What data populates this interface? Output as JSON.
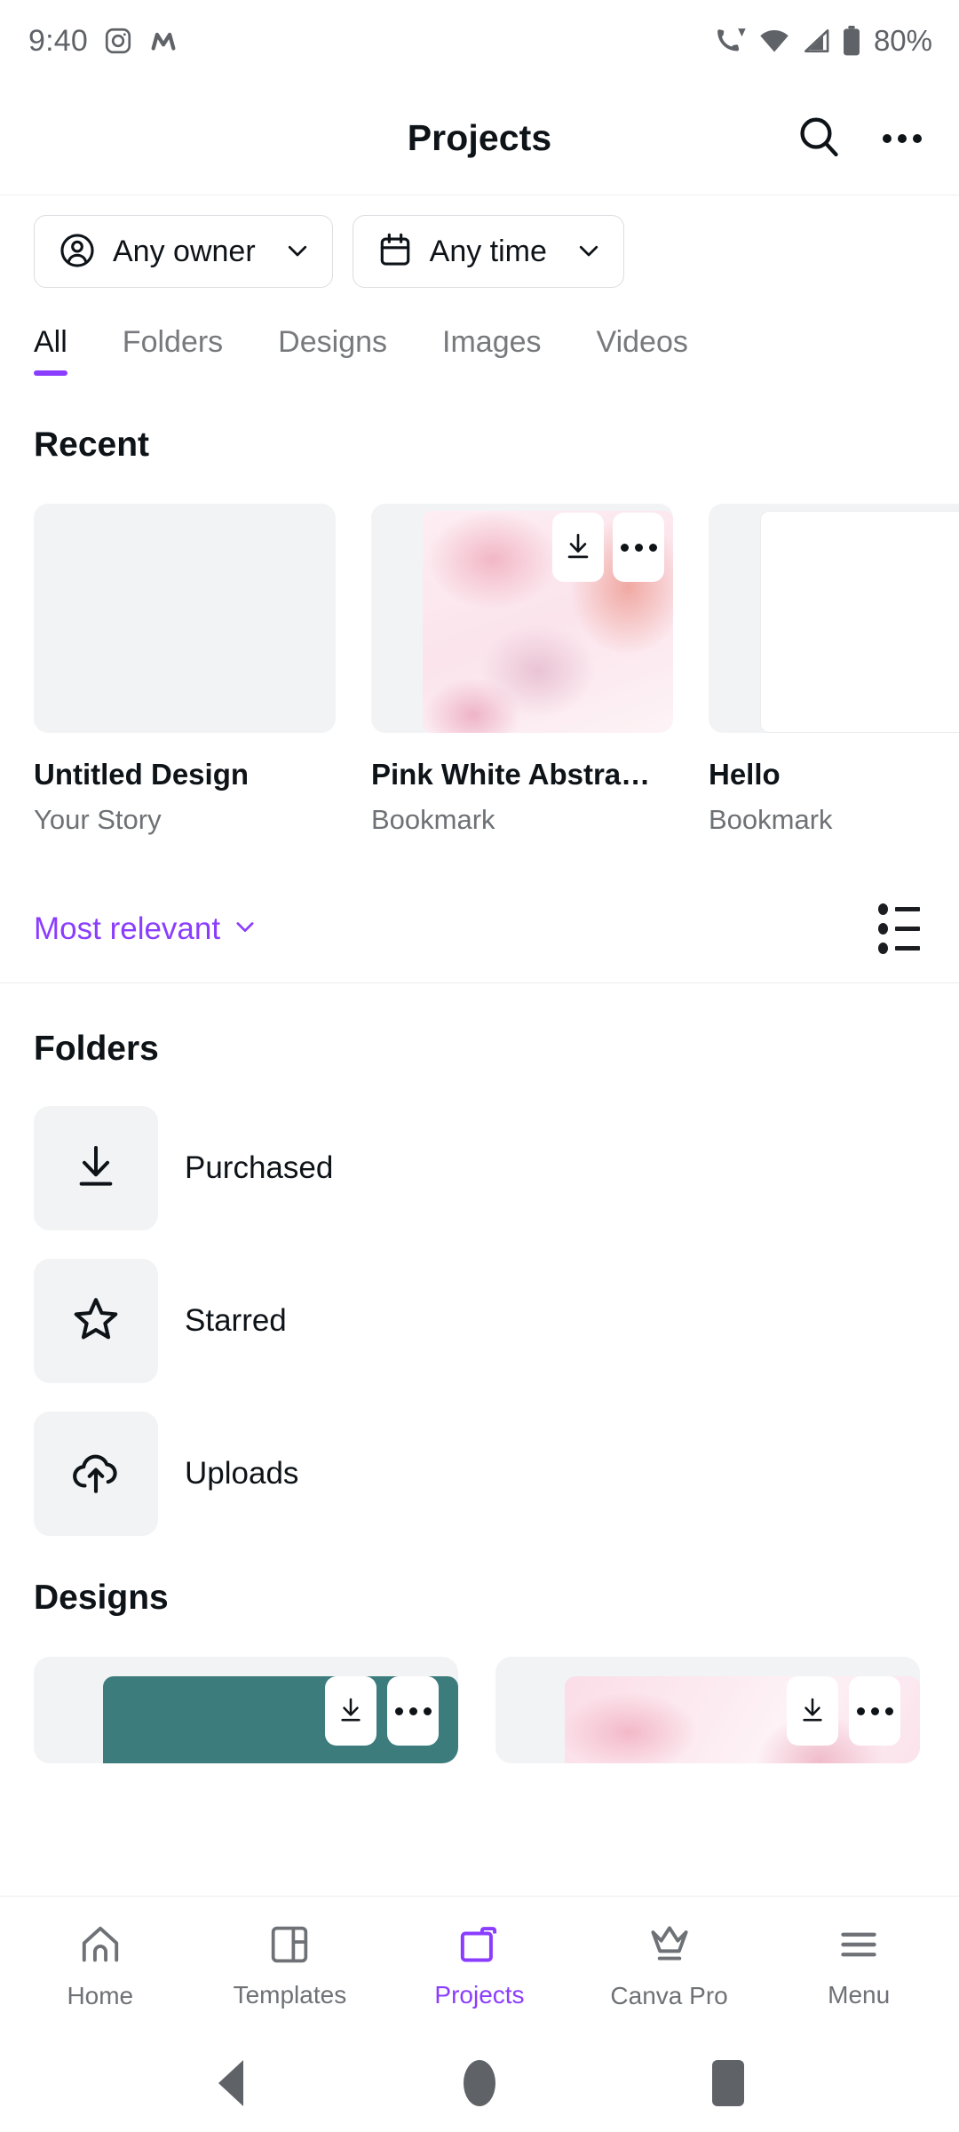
{
  "status_bar": {
    "time": "9:40",
    "battery_text": "80%",
    "left_icons": [
      "instagram-icon",
      "m-app-icon"
    ],
    "right_icons": [
      "call-wifi-icon",
      "wifi-icon",
      "cellular-signal-icon",
      "battery-icon"
    ]
  },
  "header": {
    "title": "Projects",
    "search_icon": "search-icon",
    "more_icon": "more-options-icon"
  },
  "filters": [
    {
      "label": "Any owner",
      "icon": "person-circle-icon"
    },
    {
      "label": "Any time",
      "icon": "calendar-icon"
    }
  ],
  "tabs": [
    {
      "label": "All",
      "active": true
    },
    {
      "label": "Folders",
      "active": false
    },
    {
      "label": "Designs",
      "active": false
    },
    {
      "label": "Images",
      "active": false
    },
    {
      "label": "Videos",
      "active": false
    }
  ],
  "recent": {
    "heading": "Recent",
    "cards": [
      {
        "title": "Untitled Design",
        "subtitle": "Your Story",
        "thumb": "blank",
        "actions": []
      },
      {
        "title": "Pink White Abstra…",
        "subtitle": "Bookmark",
        "thumb": "pink",
        "actions": [
          "download-icon",
          "more-options-icon"
        ]
      },
      {
        "title": "Hello",
        "subtitle": "Bookmark",
        "thumb": "white",
        "actions": [
          "download-icon"
        ]
      }
    ]
  },
  "sort": {
    "label": "Most relevant",
    "chevron_icon": "chevron-down-icon",
    "view_toggle_icon": "list-view-icon",
    "accent_color": "#8b3dff"
  },
  "folders": {
    "heading": "Folders",
    "items": [
      {
        "label": "Purchased",
        "icon": "download-icon"
      },
      {
        "label": "Starred",
        "icon": "star-outline-icon"
      },
      {
        "label": "Uploads",
        "icon": "cloud-upload-icon"
      }
    ]
  },
  "designs": {
    "heading": "Designs",
    "cards": [
      {
        "thumb": "teal",
        "color": "#3d7c7c",
        "actions": [
          "download-icon",
          "more-options-icon"
        ]
      },
      {
        "thumb": "pink",
        "color": "#fbdde7",
        "actions": [
          "download-icon",
          "more-options-icon"
        ]
      }
    ]
  },
  "bottom_nav": [
    {
      "label": "Home",
      "icon": "home-icon",
      "active": false
    },
    {
      "label": "Templates",
      "icon": "templates-icon",
      "active": false
    },
    {
      "label": "Projects",
      "icon": "folder-icon",
      "active": true
    },
    {
      "label": "Canva Pro",
      "icon": "crown-icon",
      "active": false
    },
    {
      "label": "Menu",
      "icon": "hamburger-menu-icon",
      "active": false
    }
  ],
  "android_nav": {
    "back": "back-triangle-icon",
    "home": "home-circle-icon",
    "recents": "recents-square-icon"
  }
}
